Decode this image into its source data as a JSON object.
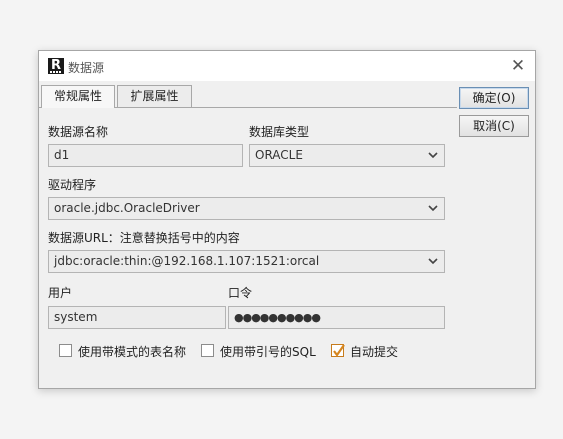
{
  "window": {
    "title": "数据源",
    "close_glyph": "✕",
    "app_icon_letter": "R"
  },
  "tabs": [
    {
      "label": "常规属性",
      "active": true
    },
    {
      "label": "扩展属性",
      "active": false
    }
  ],
  "buttons": {
    "ok": "确定(O)",
    "cancel": "取消(C)"
  },
  "form": {
    "datasource_name": {
      "label": "数据源名称",
      "value": "d1"
    },
    "db_type": {
      "label": "数据库类型",
      "value": "ORACLE"
    },
    "driver": {
      "label": "驱动程序",
      "value": "oracle.jdbc.OracleDriver"
    },
    "url": {
      "label": "数据源URL：注意替换括号中的内容",
      "value": "jdbc:oracle:thin:@192.168.1.107:1521:orcal"
    },
    "user": {
      "label": "用户",
      "value": "system"
    },
    "password": {
      "label": "口令",
      "value": "●●●●●●●●●●"
    }
  },
  "options": [
    {
      "label": "使用带模式的表名称",
      "checked": false
    },
    {
      "label": "使用带引号的SQL",
      "checked": false
    },
    {
      "label": "自动提交",
      "checked": true
    }
  ],
  "colors": {
    "accent_checkbox": "#c77c1d",
    "primary_button_border": "#6a8fb4"
  }
}
